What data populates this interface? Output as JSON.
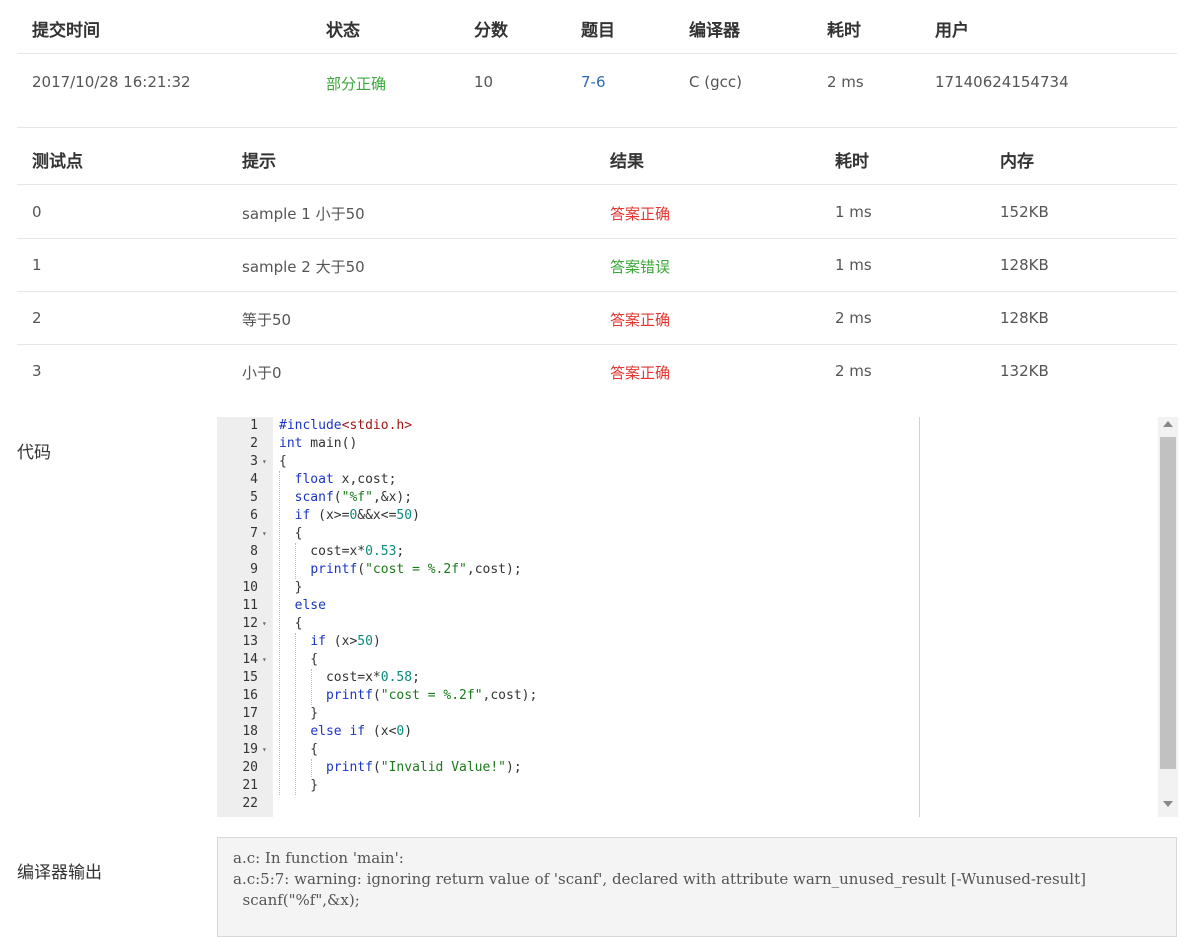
{
  "submission": {
    "headers": [
      "提交时间",
      "状态",
      "分数",
      "题目",
      "编译器",
      "耗时",
      "用户"
    ],
    "row": {
      "time": "2017/10/28 16:21:32",
      "status": "部分正确",
      "score": "10",
      "problem": "7-6",
      "compiler": "C (gcc)",
      "duration": "2 ms",
      "user": "17140624154734"
    }
  },
  "testcases": {
    "headers": [
      "测试点",
      "提示",
      "结果",
      "耗时",
      "内存"
    ],
    "rows": [
      {
        "id": "0",
        "hint": "sample 1 小于50",
        "result": "答案正确",
        "time": "1 ms",
        "memory": "152KB"
      },
      {
        "id": "1",
        "hint": "sample 2 大于50",
        "result": "答案错误",
        "time": "1 ms",
        "memory": "128KB"
      },
      {
        "id": "2",
        "hint": "等于50",
        "result": "答案正确",
        "time": "2 ms",
        "memory": "128KB"
      },
      {
        "id": "3",
        "hint": "小于0",
        "result": "答案正确",
        "time": "2 ms",
        "memory": "132KB"
      }
    ]
  },
  "code_section": {
    "label": "代码",
    "lines": [
      "#include<stdio.h>",
      "int main()",
      "{",
      "  float x,cost;",
      "  scanf(\"%f\",&x);",
      "  if (x>=0&&x<=50)",
      "  {",
      "    cost=x*0.53;",
      "    printf(\"cost = %.2f\",cost);",
      "  }",
      "  else",
      "  {",
      "    if (x>50)",
      "    {",
      "      cost=x*0.58;",
      "      printf(\"cost = %.2f\",cost);",
      "    }",
      "    else if (x<0)",
      "    {",
      "      printf(\"Invalid Value!\");",
      "    }",
      ""
    ],
    "line_numbers": [
      "1",
      "2",
      "3",
      "4",
      "5",
      "6",
      "7",
      "8",
      "9",
      "10",
      "11",
      "12",
      "13",
      "14",
      "15",
      "16",
      "17",
      "18",
      "19",
      "20",
      "21",
      "22"
    ],
    "foldable_lines": [
      "3",
      "7",
      "12",
      "14",
      "19"
    ]
  },
  "compiler_output": {
    "label": "编译器输出",
    "text": "a.c: In function 'main':\na.c:5:7: warning: ignoring return value of 'scanf', declared with attribute warn_unused_result [-Wunused-result]\n  scanf(\"%f\",&x);"
  },
  "colors": {
    "status_partial": "#3aa83a",
    "result_correct": "#e5352f",
    "result_wrong": "#3aa83a",
    "link": "#2b6cb5",
    "keyword": "#1c35c8",
    "string": "#a31515"
  }
}
